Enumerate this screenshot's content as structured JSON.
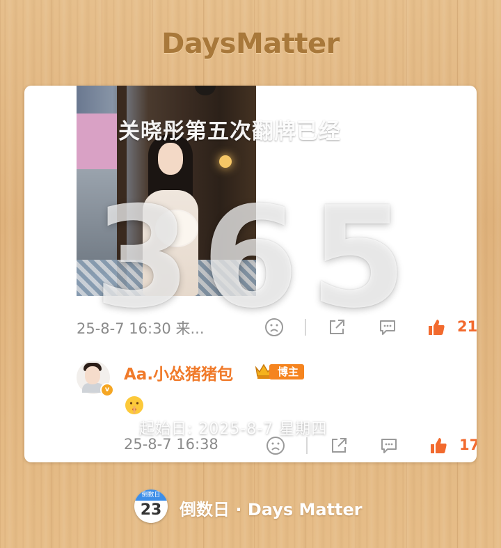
{
  "app_title": "DaysMatter",
  "card": {
    "post_caption": "关晓彤第五次翻牌已经",
    "days_count": "365",
    "post_meta": {
      "time": "25-8-7 16:30 来...",
      "like_count": "21"
    },
    "comment": {
      "username": "Aa.小怂猪猪包",
      "avatar_badge": "v",
      "tag": "博主",
      "emoji": "shushing-face",
      "time": "25-8-7 16:38",
      "like_count": "17"
    },
    "start_date": "起始日: 2025-8-7 星期四"
  },
  "footer": {
    "calendar_icon_top": "倒数日",
    "calendar_icon_day": "23",
    "label": "倒数日 · Days Matter"
  },
  "colors": {
    "accent_orange": "#f26a2e",
    "title_brown": "#a8783a",
    "username_orange": "#f07a2a"
  }
}
